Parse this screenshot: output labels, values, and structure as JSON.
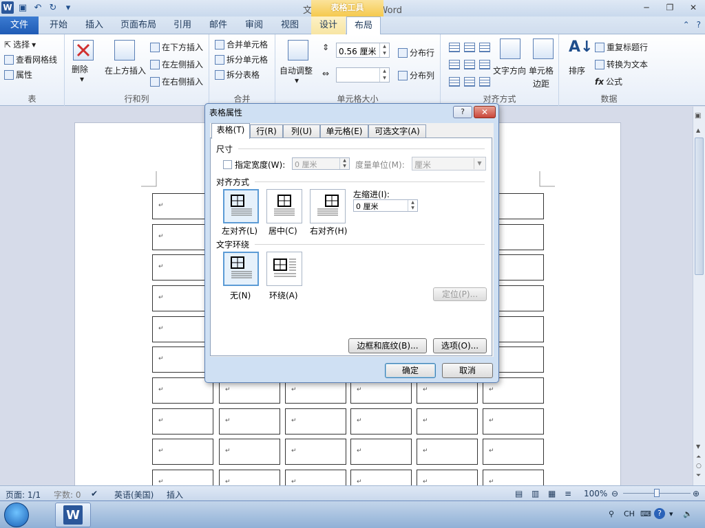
{
  "window": {
    "title": "文档1  -  Microsoft Word",
    "context_tab": "表格工具"
  },
  "tabs": {
    "file": "文件",
    "items": [
      "开始",
      "插入",
      "页面布局",
      "引用",
      "邮件",
      "审阅",
      "视图",
      "设计",
      "布局"
    ],
    "active": "布局"
  },
  "ribbon": {
    "table_group": {
      "label": "表",
      "select": "选择",
      "gridlines": "查看网格线",
      "properties": "属性"
    },
    "rows_cols": {
      "label": "行和列",
      "delete": "删除",
      "insert_above": "在上方插入",
      "insert_below": "在下方插入",
      "insert_left": "在左侧插入",
      "insert_right": "在右侧插入"
    },
    "merge": {
      "label": "合并",
      "merge_cells": "合并单元格",
      "split_cells": "拆分单元格",
      "split_table": "拆分表格"
    },
    "cell_size": {
      "label": "单元格大小",
      "autofit": "自动调整",
      "height_value": "0.56 厘米",
      "width_value": "",
      "dist_rows": "分布行",
      "dist_cols": "分布列"
    },
    "alignment": {
      "label": "对齐方式",
      "text_direction": "文字方向",
      "cell_margins_1": "单元格",
      "cell_margins_2": "边距"
    },
    "data": {
      "label": "数据",
      "sort": "排序",
      "repeat_header": "重复标题行",
      "convert_text": "转换为文本",
      "formula": "公式"
    }
  },
  "document": {
    "cell_mark": "↵"
  },
  "status": {
    "page": "页面: 1/1",
    "words": "字数: 0",
    "language": "英语(美国)",
    "mode": "插入",
    "zoom": "100%"
  },
  "taskbar": {
    "lang": "CH"
  },
  "dialog": {
    "title": "表格属性",
    "help": "?",
    "close": "✕",
    "tabs": [
      "表格(T)",
      "行(R)",
      "列(U)",
      "单元格(E)",
      "可选文字(A)"
    ],
    "size_section": "尺寸",
    "specify_width": "指定宽度(W):",
    "width_value": "0 厘米",
    "measure_in": "度量单位(M):",
    "measure_value": "厘米",
    "alignment_section": "对齐方式",
    "align_left": "左对齐(L)",
    "align_center": "居中(C)",
    "align_right": "右对齐(H)",
    "indent_label": "左缩进(I):",
    "indent_value": "0 厘米",
    "wrap_section": "文字环绕",
    "wrap_none": "无(N)",
    "wrap_around": "环绕(A)",
    "positioning": "定位(P)...",
    "borders": "边框和底纹(B)...",
    "options": "选项(O)...",
    "ok": "确定",
    "cancel": "取消"
  }
}
